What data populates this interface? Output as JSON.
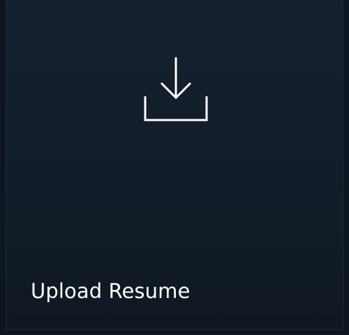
{
  "tile": {
    "label": "Upload Resume",
    "icon": "download-icon",
    "colors": {
      "background": "#121d29",
      "text": "#ffffff",
      "icon": "#ffffff"
    }
  }
}
